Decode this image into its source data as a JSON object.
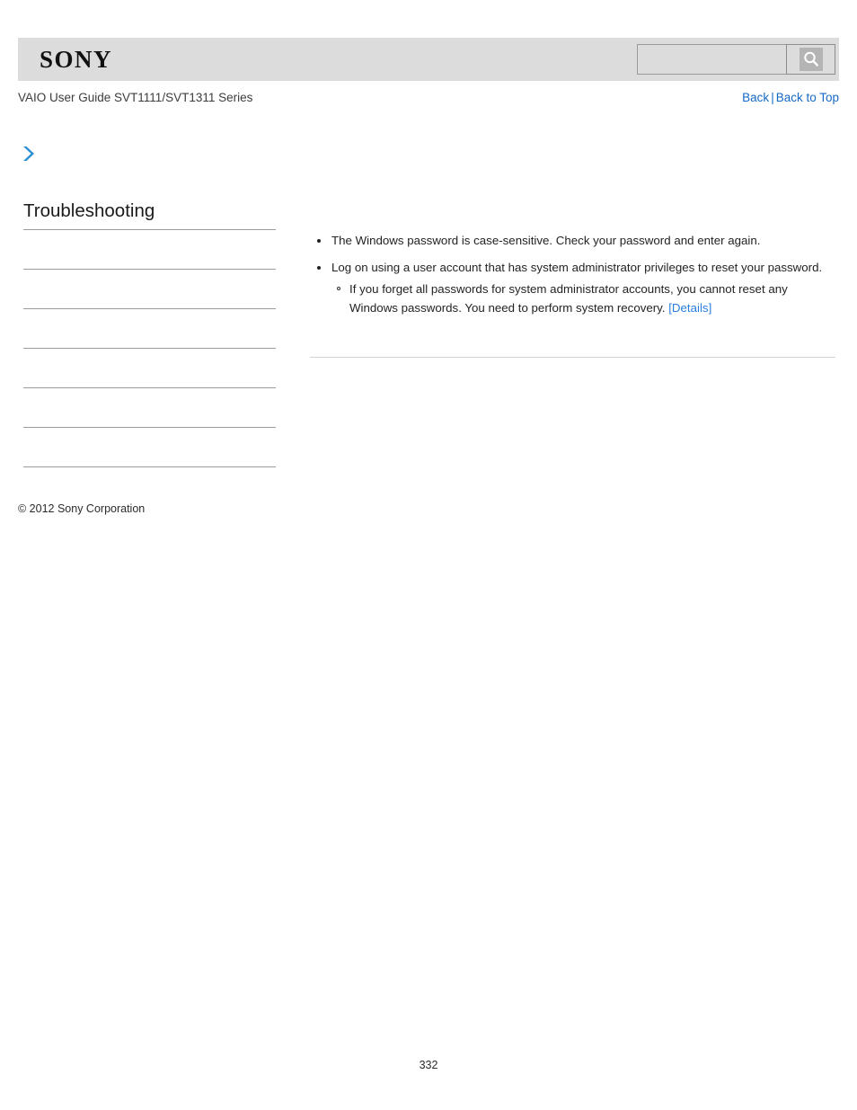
{
  "header": {
    "logo_text": "SONY",
    "search": {
      "value": "",
      "placeholder": "",
      "icon": "search-icon"
    }
  },
  "subheader": {
    "guide_title": "VAIO User Guide SVT1111/SVT1311 Series",
    "nav": {
      "back_label": "Back",
      "separator": "|",
      "back_to_top_label": "Back to Top"
    }
  },
  "breadcrumb": {
    "icon": "chevron-right-icon",
    "text": ""
  },
  "sidebar": {
    "section_title": "Troubleshooting",
    "items": [
      {
        "label": ""
      },
      {
        "label": ""
      },
      {
        "label": ""
      },
      {
        "label": ""
      },
      {
        "label": ""
      },
      {
        "label": ""
      }
    ]
  },
  "content": {
    "bullets": [
      {
        "text": "The Windows password is case-sensitive. Check your password and enter again.",
        "sub": []
      },
      {
        "text": "Log on using a user account that has system administrator privileges to reset your password.",
        "sub": [
          {
            "text": "If you forget all passwords for system administrator accounts, you cannot reset any Windows passwords. You need to perform system recovery. ",
            "link_label": "[Details]"
          }
        ]
      }
    ]
  },
  "footer": {
    "copyright": "© 2012 Sony Corporation",
    "page_number": "332"
  },
  "colors": {
    "header_band": "#dcdcdc",
    "link_blue": "#1569c7",
    "details_link_blue": "#2a7de1",
    "chevron_blue": "#2b8fd4",
    "rule_gray": "#9b9b9b"
  }
}
